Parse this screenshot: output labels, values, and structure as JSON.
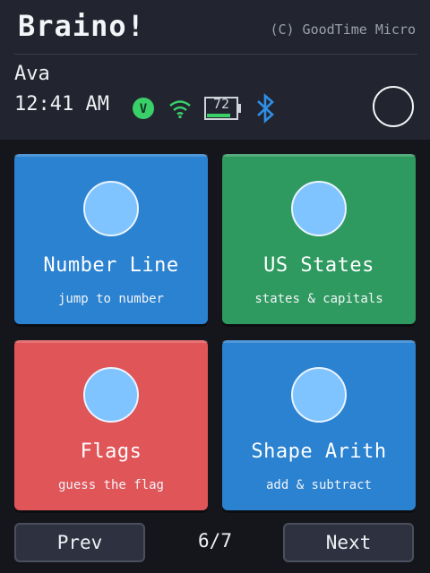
{
  "header": {
    "title": "Braino!",
    "copyright": "(C) GoodTime Micro",
    "user_name": "Ava",
    "time": "12:41 AM",
    "status_badge_letter": "V",
    "battery_level": "72"
  },
  "colors": {
    "blue": "#2a82d0",
    "green": "#2f9a60",
    "red": "#e05558",
    "circle": "#7fc3ff",
    "bluetooth": "#2f8fe6",
    "wifi": "#39d06a"
  },
  "tiles": [
    {
      "label": "Number Line",
      "subtitle": "jump to number"
    },
    {
      "label": "US States",
      "subtitle": "states & capitals"
    },
    {
      "label": "Flags",
      "subtitle": "guess the flag"
    },
    {
      "label": "Shape Arith",
      "subtitle": "add & subtract"
    }
  ],
  "footer": {
    "prev_label": "Prev",
    "next_label": "Next",
    "page_indicator": "6/7"
  }
}
